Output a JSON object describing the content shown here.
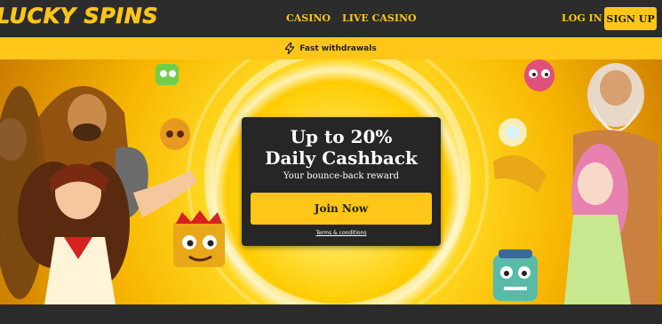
{
  "brand": {
    "logo_text": "LUCKY SPINS",
    "accent_color": "#ffc61a"
  },
  "header": {
    "nav": [
      "CASINO",
      "LIVE CASINO"
    ],
    "login_label": "LOG IN",
    "signup_label": "SIGN UP"
  },
  "promo_bar": {
    "icon": "lightning-icon",
    "text": "Fast withdrawals"
  },
  "hero": {
    "title_line1": "Up to 20%",
    "title_line2": "Daily Cashback",
    "subtitle": "Your bounce-back reward",
    "cta_label": "Join Now",
    "terms_label": "Terms & conditions"
  }
}
